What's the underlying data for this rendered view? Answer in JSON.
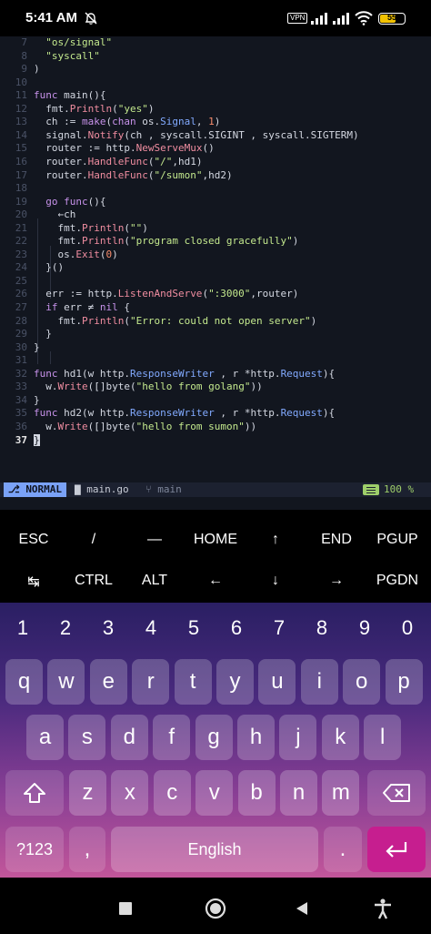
{
  "status_bar": {
    "time": "5:41 AM",
    "vpn": "VPN",
    "battery": "55"
  },
  "editor": {
    "lines": [
      {
        "n": "7",
        "code": "  \"os/signal\""
      },
      {
        "n": "8",
        "code": "  \"syscall\""
      },
      {
        "n": "9",
        "code": ")"
      },
      {
        "n": "10",
        "code": ""
      },
      {
        "n": "11",
        "code": "func main(){"
      },
      {
        "n": "12",
        "code": "  fmt.Println(\"yes\")"
      },
      {
        "n": "13",
        "code": "  ch := make(chan os.Signal, 1)"
      },
      {
        "n": "14",
        "code": "  signal.Notify(ch , syscall.SIGINT , syscall.SIGTERM)"
      },
      {
        "n": "15",
        "code": "  router := http.NewServeMux()"
      },
      {
        "n": "16",
        "code": "  router.HandleFunc(\"/\",hd1)"
      },
      {
        "n": "17",
        "code": "  router.HandleFunc(\"/sumon\",hd2)"
      },
      {
        "n": "18",
        "code": ""
      },
      {
        "n": "19",
        "code": "  go func(){"
      },
      {
        "n": "20",
        "code": "    ←ch"
      },
      {
        "n": "21",
        "code": "    fmt.Println(\"\")"
      },
      {
        "n": "22",
        "code": "    fmt.Println(\"program closed gracefully\")"
      },
      {
        "n": "23",
        "code": "    os.Exit(0)"
      },
      {
        "n": "24",
        "code": "  }()"
      },
      {
        "n": "25",
        "code": ""
      },
      {
        "n": "26",
        "code": "  err := http.ListenAndServe(\":3000\",router)"
      },
      {
        "n": "27",
        "code": "  if err ≠ nil {"
      },
      {
        "n": "28",
        "code": "    fmt.Println(\"Error: could not open server\")"
      },
      {
        "n": "29",
        "code": "  }"
      },
      {
        "n": "30",
        "code": "}"
      },
      {
        "n": "31",
        "code": ""
      },
      {
        "n": "32",
        "code": "func hd1(w http.ResponseWriter , r *http.Request){"
      },
      {
        "n": "33",
        "code": "  w.Write([]byte(\"hello from golang\"))"
      },
      {
        "n": "34",
        "code": "}"
      },
      {
        "n": "35",
        "code": "func hd2(w http.ResponseWriter , r *http.Request){"
      },
      {
        "n": "36",
        "code": "  w.Write([]byte(\"hello from sumon\"))"
      },
      {
        "n": "37",
        "code": "}"
      }
    ],
    "current_line": "37"
  },
  "vim_status": {
    "mode": "NORMAL",
    "file": "main.go",
    "branch": "main",
    "percent": "100 %"
  },
  "extra_keys": {
    "row1": [
      "ESC",
      "/",
      "—",
      "HOME",
      "↑",
      "END",
      "PGUP"
    ],
    "row2": [
      "↹",
      "CTRL",
      "ALT",
      "←",
      "↓",
      "→",
      "PGDN"
    ]
  },
  "keyboard": {
    "numbers": [
      "1",
      "2",
      "3",
      "4",
      "5",
      "6",
      "7",
      "8",
      "9",
      "0"
    ],
    "row1": [
      "q",
      "w",
      "e",
      "r",
      "t",
      "y",
      "u",
      "i",
      "o",
      "p"
    ],
    "row2": [
      "a",
      "s",
      "d",
      "f",
      "g",
      "h",
      "j",
      "k",
      "l"
    ],
    "row3": [
      "z",
      "x",
      "c",
      "v",
      "b",
      "n",
      "m"
    ],
    "symbols_key": "?123",
    "comma_key": ",",
    "space_label": "English",
    "period_key": ".",
    "colors": {
      "enter": "#c61e8f",
      "gradient_top": "#2a1f63",
      "gradient_bottom": "#c2569a"
    }
  },
  "nav_bar": {
    "icons": [
      "recents-square-icon",
      "home-circle-icon",
      "back-triangle-icon",
      "accessibility-icon"
    ]
  }
}
